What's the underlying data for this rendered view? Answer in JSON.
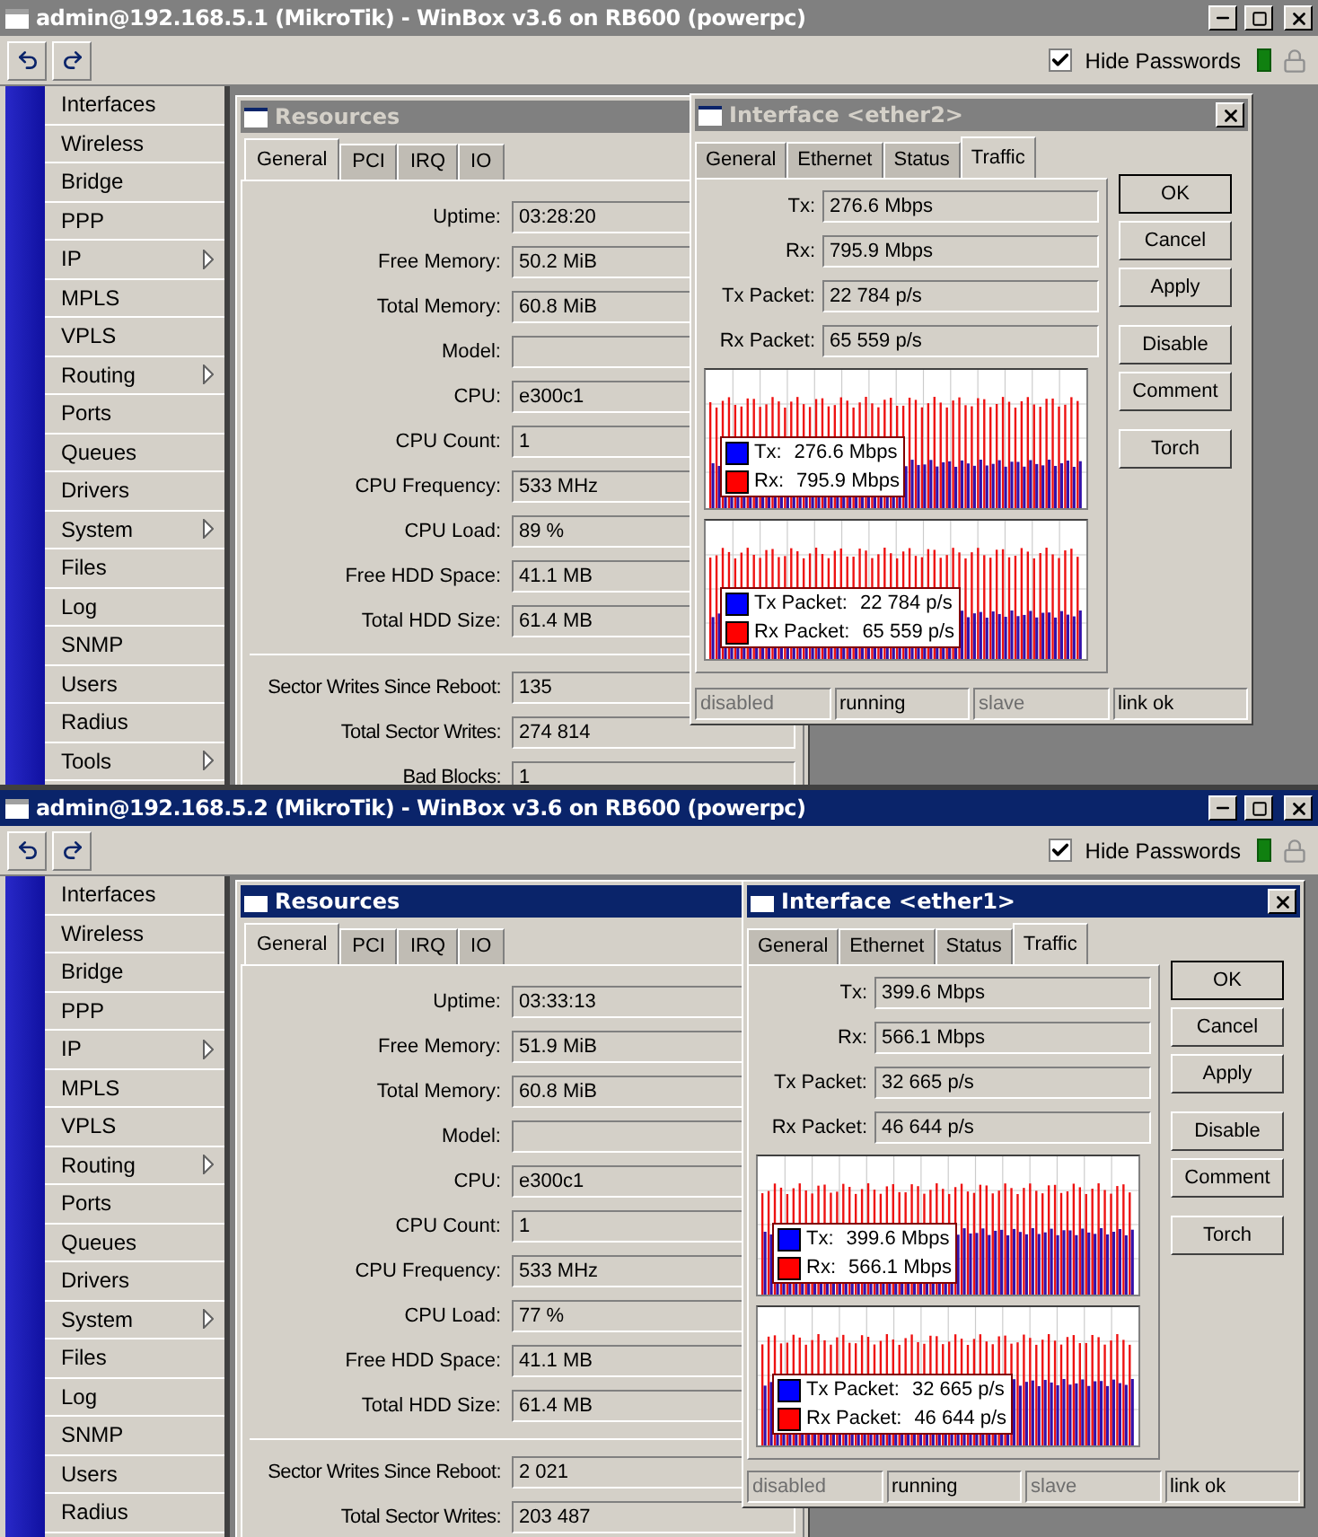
{
  "windows": [
    {
      "title": "admin@192.168.5.1 (MikroTik) - WinBox v3.6 on RB600 (powerpc)",
      "active": false,
      "hide_passwords": {
        "label": "Hide Passwords",
        "checked": true
      },
      "menu": [
        {
          "label": "Interfaces",
          "submenu": false
        },
        {
          "label": "Wireless",
          "submenu": false
        },
        {
          "label": "Bridge",
          "submenu": false
        },
        {
          "label": "PPP",
          "submenu": false
        },
        {
          "label": "IP",
          "submenu": true
        },
        {
          "label": "MPLS",
          "submenu": false
        },
        {
          "label": "VPLS",
          "submenu": false
        },
        {
          "label": "Routing",
          "submenu": true
        },
        {
          "label": "Ports",
          "submenu": false
        },
        {
          "label": "Queues",
          "submenu": false
        },
        {
          "label": "Drivers",
          "submenu": false
        },
        {
          "label": "System",
          "submenu": true
        },
        {
          "label": "Files",
          "submenu": false
        },
        {
          "label": "Log",
          "submenu": false
        },
        {
          "label": "SNMP",
          "submenu": false
        },
        {
          "label": "Users",
          "submenu": false
        },
        {
          "label": "Radius",
          "submenu": false
        },
        {
          "label": "Tools",
          "submenu": true
        }
      ],
      "resources": {
        "title": "Resources",
        "tabs": [
          {
            "label": "General",
            "selected": true
          },
          {
            "label": "PCI",
            "selected": false
          },
          {
            "label": "IRQ",
            "selected": false
          },
          {
            "label": "IO",
            "selected": false
          }
        ],
        "fields": [
          {
            "label": "Uptime:",
            "value": "03:28:20"
          },
          {
            "label": "Free Memory:",
            "value": "50.2 MiB"
          },
          {
            "label": "Total Memory:",
            "value": "60.8 MiB"
          },
          {
            "label": "Model:"
          },
          {
            "label": "CPU:",
            "value": "e300c1"
          },
          {
            "label": "CPU Count:",
            "value": "1"
          },
          {
            "label": "CPU Frequency:",
            "value": "533 MHz"
          },
          {
            "label": "CPU Load:",
            "value": "89 %"
          },
          {
            "label": "Free HDD Space:",
            "value": "41.1 MB"
          },
          {
            "label": "Total HDD Size:",
            "value": "61.4 MB"
          }
        ],
        "sector_fields": [
          {
            "label": "Sector Writes Since Reboot:",
            "value": "135"
          },
          {
            "label": "Total Sector Writes:",
            "value": "274 814"
          },
          {
            "label": "Bad Blocks:",
            "value": "1"
          }
        ]
      },
      "interface": {
        "title": "Interface <ether2>",
        "tabs": [
          {
            "label": "General",
            "selected": false
          },
          {
            "label": "Ethernet",
            "selected": false
          },
          {
            "label": "Status",
            "selected": false
          },
          {
            "label": "Traffic",
            "selected": true
          }
        ],
        "fields": [
          {
            "label": "Tx:",
            "value": "276.6 Mbps"
          },
          {
            "label": "Rx:",
            "value": "795.9 Mbps"
          },
          {
            "label": "Tx Packet:",
            "value": "22 784 p/s"
          },
          {
            "label": "Rx Packet:",
            "value": "65 559 p/s"
          }
        ],
        "graphs": [
          {
            "legend": [
              {
                "label": "Tx:",
                "value": "276.6 Mbps",
                "color": "#0000ff"
              },
              {
                "label": "Rx:",
                "value": "795.9 Mbps",
                "color": "#ff0000"
              }
            ]
          },
          {
            "legend": [
              {
                "label": "Tx Packet:",
                "value": "22 784 p/s",
                "color": "#0000ff"
              },
              {
                "label": "Rx Packet:",
                "value": "65 559 p/s",
                "color": "#ff0000"
              }
            ]
          }
        ],
        "buttons": [
          "OK",
          "Cancel",
          "Apply",
          "Disable",
          "Comment",
          "Torch"
        ],
        "status": [
          {
            "text": "disabled",
            "disabled": true
          },
          {
            "text": "running",
            "disabled": false
          },
          {
            "text": "slave",
            "disabled": true
          },
          {
            "text": "link ok",
            "disabled": false
          }
        ]
      }
    },
    {
      "title": "admin@192.168.5.2 (MikroTik) - WinBox v3.6 on RB600 (powerpc)",
      "active": true,
      "hide_passwords": {
        "label": "Hide Passwords",
        "checked": true
      },
      "menu": [
        {
          "label": "Interfaces",
          "submenu": false
        },
        {
          "label": "Wireless",
          "submenu": false
        },
        {
          "label": "Bridge",
          "submenu": false
        },
        {
          "label": "PPP",
          "submenu": false
        },
        {
          "label": "IP",
          "submenu": true
        },
        {
          "label": "MPLS",
          "submenu": false
        },
        {
          "label": "VPLS",
          "submenu": false
        },
        {
          "label": "Routing",
          "submenu": true
        },
        {
          "label": "Ports",
          "submenu": false
        },
        {
          "label": "Queues",
          "submenu": false
        },
        {
          "label": "Drivers",
          "submenu": false
        },
        {
          "label": "System",
          "submenu": true
        },
        {
          "label": "Files",
          "submenu": false
        },
        {
          "label": "Log",
          "submenu": false
        },
        {
          "label": "SNMP",
          "submenu": false
        },
        {
          "label": "Users",
          "submenu": false
        },
        {
          "label": "Radius",
          "submenu": false
        }
      ],
      "resources": {
        "title": "Resources",
        "tabs": [
          {
            "label": "General",
            "selected": true
          },
          {
            "label": "PCI",
            "selected": false
          },
          {
            "label": "IRQ",
            "selected": false
          },
          {
            "label": "IO",
            "selected": false
          }
        ],
        "fields": [
          {
            "label": "Uptime:",
            "value": "03:33:13"
          },
          {
            "label": "Free Memory:",
            "value": "51.9 MiB"
          },
          {
            "label": "Total Memory:",
            "value": "60.8 MiB"
          },
          {
            "label": "Model:"
          },
          {
            "label": "CPU:",
            "value": "e300c1"
          },
          {
            "label": "CPU Count:",
            "value": "1"
          },
          {
            "label": "CPU Frequency:",
            "value": "533 MHz"
          },
          {
            "label": "CPU Load:",
            "value": "77 %"
          },
          {
            "label": "Free HDD Space:",
            "value": "41.1 MB"
          },
          {
            "label": "Total HDD Size:",
            "value": "61.4 MB"
          }
        ],
        "sector_fields": [
          {
            "label": "Sector Writes Since Reboot:",
            "value": "2 021"
          },
          {
            "label": "Total Sector Writes:",
            "value": "203 487"
          }
        ]
      },
      "interface": {
        "title": "Interface <ether1>",
        "tabs": [
          {
            "label": "General",
            "selected": false
          },
          {
            "label": "Ethernet",
            "selected": false
          },
          {
            "label": "Status",
            "selected": false
          },
          {
            "label": "Traffic",
            "selected": true
          }
        ],
        "fields": [
          {
            "label": "Tx:",
            "value": "399.6 Mbps"
          },
          {
            "label": "Rx:",
            "value": "566.1 Mbps"
          },
          {
            "label": "Tx Packet:",
            "value": "32 665 p/s"
          },
          {
            "label": "Rx Packet:",
            "value": "46 644 p/s"
          }
        ],
        "graphs": [
          {
            "legend": [
              {
                "label": "Tx:",
                "value": "399.6 Mbps",
                "color": "#0000ff"
              },
              {
                "label": "Rx:",
                "value": "566.1 Mbps",
                "color": "#ff0000"
              }
            ]
          },
          {
            "legend": [
              {
                "label": "Tx Packet:",
                "value": "32 665 p/s",
                "color": "#0000ff"
              },
              {
                "label": "Rx Packet:",
                "value": "46 644 p/s",
                "color": "#ff0000"
              }
            ]
          }
        ],
        "buttons": [
          "OK",
          "Cancel",
          "Apply",
          "Disable",
          "Comment",
          "Torch"
        ],
        "status": [
          {
            "text": "disabled",
            "disabled": true
          },
          {
            "text": "running",
            "disabled": false
          },
          {
            "text": "slave",
            "disabled": true
          },
          {
            "text": "link ok",
            "disabled": false
          }
        ]
      }
    }
  ]
}
